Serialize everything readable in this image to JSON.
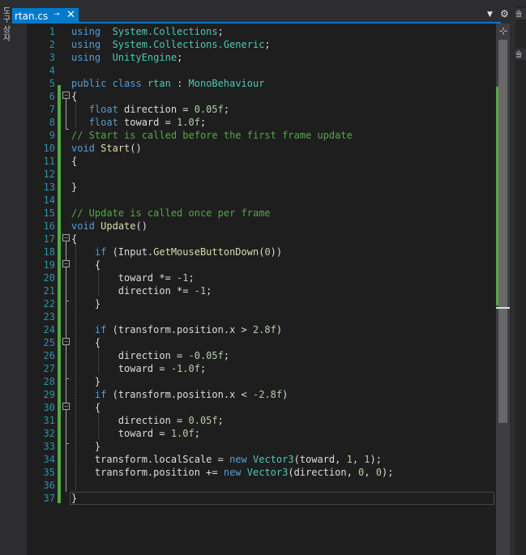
{
  "left_strip": {
    "label": "도구 상자"
  },
  "tab": {
    "title": "rtan.cs",
    "pin": "⊸",
    "close": "✕"
  },
  "toolbar": {
    "dropdown": "▼",
    "settings": "⚙"
  },
  "scroll": {
    "split": "⊹",
    "position_fraction": 0.53
  },
  "right_panel": {
    "tab1": "솔",
    "tab2": "솔"
  },
  "line_numbers": [
    "1",
    "2",
    "3",
    "4",
    "5",
    "6",
    "7",
    "8",
    "9",
    "10",
    "11",
    "12",
    "13",
    "14",
    "15",
    "16",
    "17",
    "18",
    "19",
    "20",
    "21",
    "22",
    "23",
    "24",
    "25",
    "26",
    "27",
    "28",
    "29",
    "30",
    "31",
    "32",
    "33",
    "34",
    "35",
    "36",
    "37"
  ],
  "code": [
    [
      [
        "kw",
        "using"
      ],
      [
        "",
        "  "
      ],
      [
        "cls",
        "System.Collections"
      ],
      [
        "",
        ";"
      ]
    ],
    [
      [
        "kw",
        "using"
      ],
      [
        "",
        "  "
      ],
      [
        "cls",
        "System.Collections.Generic"
      ],
      [
        "",
        ";"
      ]
    ],
    [
      [
        "kw",
        "using"
      ],
      [
        "",
        "  "
      ],
      [
        "cls",
        "UnityEngine"
      ],
      [
        "",
        ";"
      ]
    ],
    [],
    [
      [
        "kw",
        "public class"
      ],
      [
        "",
        " "
      ],
      [
        "cls",
        "rtan"
      ],
      [
        "",
        " : "
      ],
      [
        "cls",
        "MonoBehaviour"
      ]
    ],
    [
      [
        "",
        "{"
      ]
    ],
    [
      [
        "",
        "   "
      ],
      [
        "kw",
        "float"
      ],
      [
        "",
        " direction = "
      ],
      [
        "num",
        "0.05f"
      ],
      [
        "",
        ";"
      ]
    ],
    [
      [
        "",
        "   "
      ],
      [
        "kw",
        "float"
      ],
      [
        "",
        " toward = "
      ],
      [
        "num",
        "1.0f"
      ],
      [
        "",
        ";"
      ]
    ],
    [
      [
        "cm",
        "// Start is called before the first frame update"
      ]
    ],
    [
      [
        "kw",
        "void"
      ],
      [
        "",
        " "
      ],
      [
        "fn",
        "Start"
      ],
      [
        "",
        "()"
      ]
    ],
    [
      [
        "",
        "{"
      ]
    ],
    [],
    [
      [
        "",
        "}"
      ]
    ],
    [],
    [
      [
        "cm",
        "// Update is called once per frame"
      ]
    ],
    [
      [
        "kw",
        "void"
      ],
      [
        "",
        " "
      ],
      [
        "fn",
        "Update"
      ],
      [
        "",
        "()"
      ]
    ],
    [
      [
        "",
        "{"
      ]
    ],
    [
      [
        "",
        "    "
      ],
      [
        "kw",
        "if"
      ],
      [
        "",
        " (Input."
      ],
      [
        "fn",
        "GetMouseButtonDown"
      ],
      [
        "",
        "("
      ],
      [
        "num",
        "0"
      ],
      [
        "",
        "))"
      ]
    ],
    [
      [
        "",
        "    {"
      ]
    ],
    [
      [
        "",
        "        toward *= "
      ],
      [
        "num",
        "-1"
      ],
      [
        "",
        ";"
      ]
    ],
    [
      [
        "",
        "        direction *= "
      ],
      [
        "num",
        "-1"
      ],
      [
        "",
        ";"
      ]
    ],
    [
      [
        "",
        "    }"
      ]
    ],
    [],
    [
      [
        "",
        "    "
      ],
      [
        "kw",
        "if"
      ],
      [
        "",
        " (transform.position.x > "
      ],
      [
        "num",
        "2.8f"
      ],
      [
        "",
        ")"
      ]
    ],
    [
      [
        "",
        "    {"
      ]
    ],
    [
      [
        "",
        "        direction = "
      ],
      [
        "num",
        "-0.05f"
      ],
      [
        "",
        ";"
      ]
    ],
    [
      [
        "",
        "        toward = "
      ],
      [
        "num",
        "-1.0f"
      ],
      [
        "",
        ";"
      ]
    ],
    [
      [
        "",
        "    }"
      ]
    ],
    [
      [
        "",
        "    "
      ],
      [
        "kw",
        "if"
      ],
      [
        "",
        " (transform.position.x < "
      ],
      [
        "num",
        "-2.8f"
      ],
      [
        "",
        ")"
      ]
    ],
    [
      [
        "",
        "    {"
      ]
    ],
    [
      [
        "",
        "        direction = "
      ],
      [
        "num",
        "0.05f"
      ],
      [
        "",
        ";"
      ]
    ],
    [
      [
        "",
        "        toward = "
      ],
      [
        "num",
        "1.0f"
      ],
      [
        "",
        ";"
      ]
    ],
    [
      [
        "",
        "    }"
      ]
    ],
    [
      [
        "",
        "    transform.localScale = "
      ],
      [
        "kw",
        "new"
      ],
      [
        "",
        " "
      ],
      [
        "cls",
        "Vector3"
      ],
      [
        "",
        "(toward, "
      ],
      [
        "num",
        "1"
      ],
      [
        "",
        ", "
      ],
      [
        "num",
        "1"
      ],
      [
        "",
        ");"
      ]
    ],
    [
      [
        "",
        "    transform.position += "
      ],
      [
        "kw",
        "new"
      ],
      [
        "",
        " "
      ],
      [
        "cls",
        "Vector3"
      ],
      [
        "",
        "(direction, "
      ],
      [
        "num",
        "0"
      ],
      [
        "",
        ", "
      ],
      [
        "num",
        "0"
      ],
      [
        "",
        ");"
      ]
    ],
    [],
    [
      [
        "",
        "}"
      ]
    ]
  ]
}
